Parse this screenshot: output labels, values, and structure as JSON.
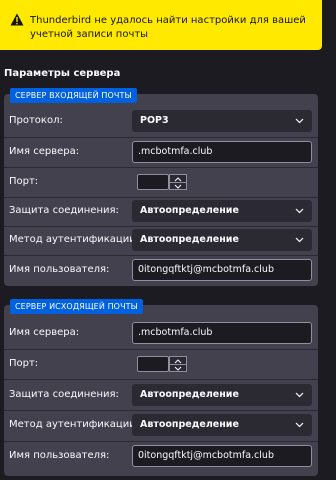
{
  "warning": {
    "text": "Thunderbird не удалось найти настройки для вашей учетной записи почты"
  },
  "section_title": "Параметры сервера",
  "incoming": {
    "legend": "СЕРВЕР ВХОДЯЩЕЙ ПОЧТЫ",
    "protocol_label": "Протокол:",
    "protocol_value": "POP3",
    "server_label": "Имя сервера:",
    "server_value": ".mcbotmfa.club",
    "port_label": "Порт:",
    "port_value": "",
    "security_label": "Защита соединения:",
    "security_value": "Автоопределение",
    "auth_label": "Метод аутентификации:",
    "auth_value": "Автоопределение",
    "username_label": "Имя пользователя:",
    "username_value": "0itongqftktj@mcbotmfa.club"
  },
  "outgoing": {
    "legend": "СЕРВЕР ИСХОДЯЩЕЙ ПОЧТЫ",
    "server_label": "Имя сервера:",
    "server_value": ".mcbotmfa.club",
    "port_label": "Порт:",
    "port_value": "",
    "security_label": "Защита соединения:",
    "security_value": "Автоопределение",
    "auth_label": "Метод аутентификации:",
    "auth_value": "Автоопределение",
    "username_label": "Имя пользователя:",
    "username_value": "0itongqftktj@mcbotmfa.club"
  },
  "colors": {
    "warning_bg": "#ffe900",
    "legend_bg": "#0061e0",
    "panel_bg": "#42414d",
    "page_bg": "#1c1b22"
  },
  "icons": [
    "warning-icon",
    "chevron-down-icon",
    "spin-up-icon",
    "spin-down-icon"
  ]
}
